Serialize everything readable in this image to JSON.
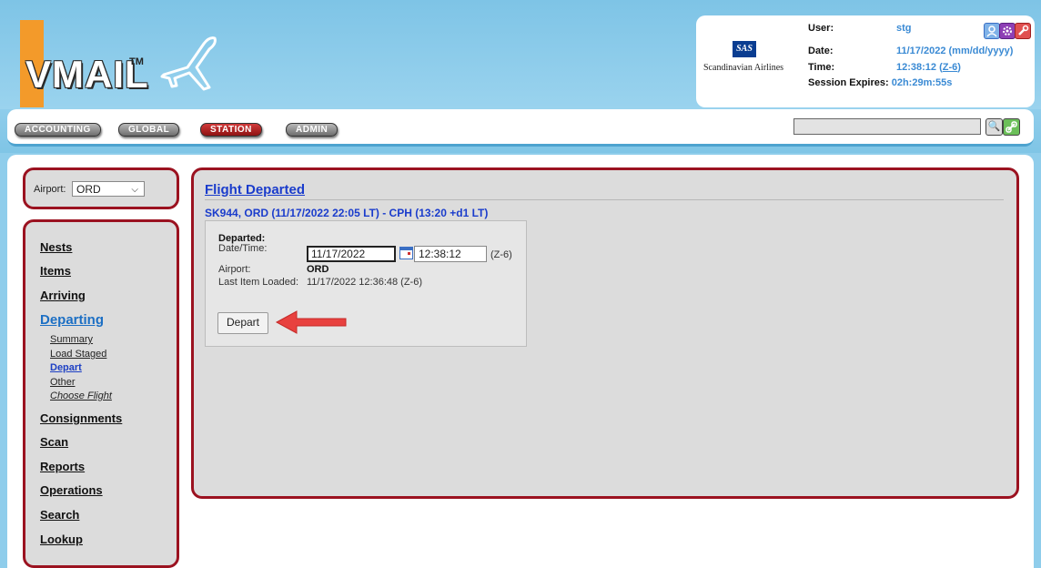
{
  "header": {
    "logo_text": "VMAIL",
    "logo_tm": "TM",
    "airline_logo_text": "SAS",
    "airline_name": "Scandinavian Airlines",
    "user_label": "User:",
    "user_value": "stg",
    "date_label": "Date:",
    "date_value": "11/17/2022 (mm/dd/yyyy)",
    "time_label": "Time:",
    "time_value": "12:38:12",
    "time_zone_link": "Z-6",
    "session_label": "Session Expires:",
    "session_value": "02h:29m:55s",
    "icons": [
      "user-icon",
      "settings-icon",
      "tools-icon"
    ]
  },
  "nav_tabs": [
    {
      "label": "ACCOUNTING",
      "active": false
    },
    {
      "label": "GLOBAL",
      "active": false
    },
    {
      "label": "STATION",
      "active": true
    },
    {
      "label": "ADMIN",
      "active": false
    }
  ],
  "search": {
    "value": "",
    "icons": [
      "search-icon",
      "link-icon"
    ]
  },
  "sidebar": {
    "airport_label": "Airport:",
    "airport_value": "ORD",
    "links": [
      {
        "label": "Nests"
      },
      {
        "label": "Items"
      },
      {
        "label": "Arriving"
      },
      {
        "label": "Departing",
        "expanded": true
      },
      {
        "label": "Consignments"
      },
      {
        "label": "Scan"
      },
      {
        "label": "Reports"
      },
      {
        "label": "Operations"
      },
      {
        "label": "Search"
      },
      {
        "label": "Lookup"
      }
    ],
    "departing_sub": [
      {
        "label": "Summary"
      },
      {
        "label": "Load Staged"
      },
      {
        "label": "Depart",
        "active": true
      },
      {
        "label": "Other"
      },
      {
        "label": "Choose Flight"
      }
    ]
  },
  "main": {
    "title": "Flight Departed",
    "flight_line": "SK944, ORD (11/17/2022 22:05 LT) - CPH (13:20 +d1 LT)",
    "form": {
      "section_label": "Departed:",
      "datetime_label": "Date/Time:",
      "date_value": "11/17/2022",
      "time_value": "12:38:12",
      "tz_label": "(Z-6)",
      "airport_label": "Airport:",
      "airport_value": "ORD",
      "last_item_label": "Last Item Loaded:",
      "last_item_value": "11/17/2022 12:36:48 (Z-6)",
      "depart_button": "Depart"
    }
  },
  "colors": {
    "header_bg": "#8fcdeb",
    "panel_border": "#9b1220",
    "link_blue": "#1a3ccc",
    "logo_orange": "#f39a2a",
    "annotation_arrow": "#e8413f"
  }
}
